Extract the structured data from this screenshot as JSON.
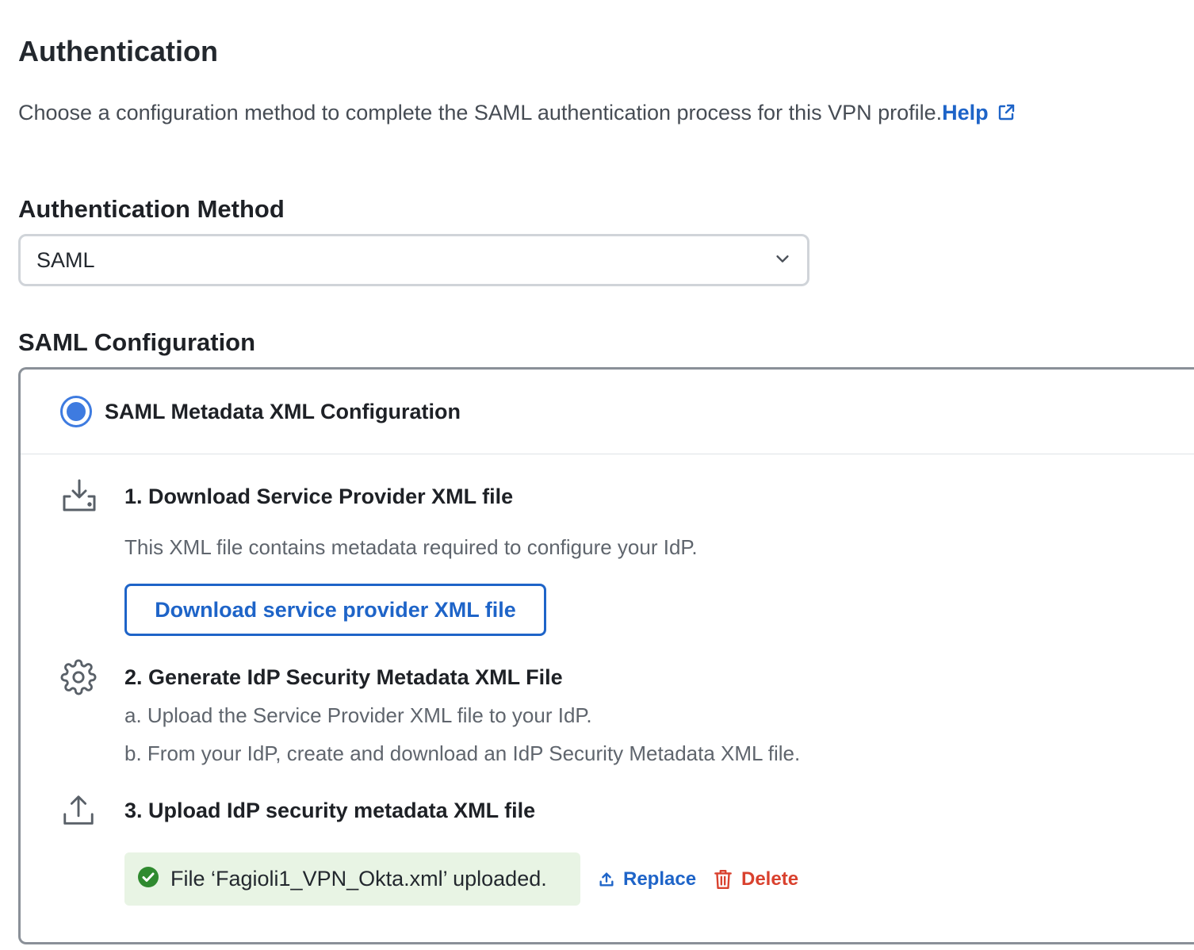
{
  "header": {
    "title": "Authentication",
    "description": "Choose a configuration method to complete the SAML authentication process for this VPN profile.",
    "help_label": "Help"
  },
  "auth_method": {
    "label": "Authentication Method",
    "selected": "SAML"
  },
  "saml_config": {
    "title": "SAML Configuration",
    "option_label": "SAML Metadata XML Configuration",
    "steps": [
      {
        "icon": "download-tray-icon",
        "title": "1. Download Service Provider XML file",
        "description": "This XML file contains metadata required to configure your IdP.",
        "button_label": "Download service provider XML file"
      },
      {
        "icon": "gear-icon",
        "title": "2. Generate IdP Security Metadata XML File",
        "line_a": "a. Upload the Service Provider XML file to your IdP.",
        "line_b": "b. From your IdP, create and download an IdP Security Metadata XML file."
      },
      {
        "icon": "upload-icon",
        "title": "3. Upload IdP security metadata XML file",
        "status_text": "File ‘Fagioli1_VPN_Okta.xml’ uploaded.",
        "replace_label": "Replace",
        "delete_label": "Delete"
      }
    ]
  },
  "colors": {
    "accent": "#1e64c8",
    "radio": "#3e7be0",
    "success": "#2f8a2f",
    "success_bg": "#e8f4e4",
    "danger": "#d9412e"
  }
}
